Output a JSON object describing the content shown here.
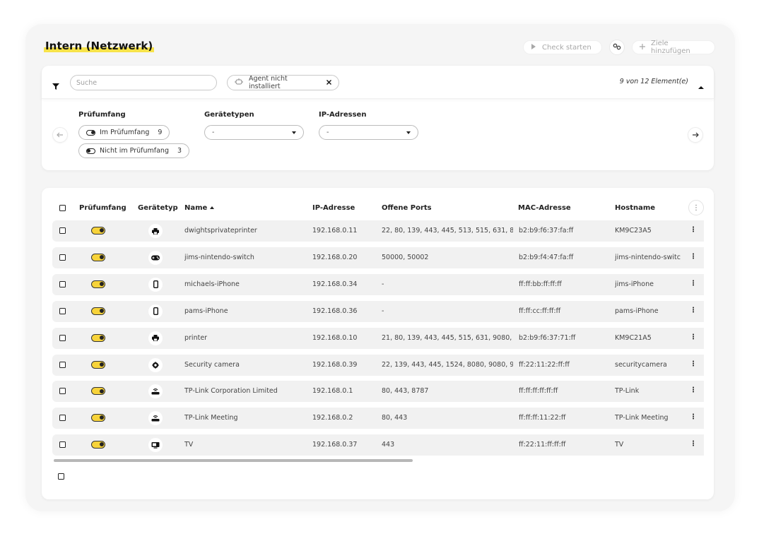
{
  "page": {
    "title": "Intern (Netzwerk)"
  },
  "actions": {
    "check_label": "Check starten",
    "add_label": "Ziele hinzufügen"
  },
  "filter_bar": {
    "search_placeholder": "Suche",
    "active_chip": "Agent nicht installiert",
    "count_label": "9 von 12 Element(e)"
  },
  "filters": {
    "scope": {
      "title": "Prüfumfang",
      "options": [
        {
          "label": "Im Prüfumfang",
          "count": "9"
        },
        {
          "label": "Nicht im Prüfumfang",
          "count": "3"
        }
      ]
    },
    "device_types": {
      "title": "Gerätetypen",
      "value": "-"
    },
    "ip_addresses": {
      "title": "IP-Adressen",
      "value": "-"
    }
  },
  "table": {
    "columns": {
      "scope": "Prüfumfang",
      "type": "Gerätetyp",
      "name": "Name",
      "ip": "IP-Adresse",
      "ports": "Offene Ports",
      "mac": "MAC-Adresse",
      "hostname": "Hostname"
    },
    "rows": [
      {
        "icon": "printer-icon",
        "name": "dwightsprivateprinter",
        "ip": "192.168.0.11",
        "ports": "22, 80, 139, 443, 445, 513, 515, 631, 8...",
        "mac": "b2:b9:f6:37:fa:ff",
        "hostname": "KM9C23A5"
      },
      {
        "icon": "gamepad-icon",
        "name": "jims-nintendo-switch",
        "ip": "192.168.0.20",
        "ports": "50000, 50002",
        "mac": "b2:b9:f4:47:fa:ff",
        "hostname": "jims-nintendo-switc"
      },
      {
        "icon": "smartphone-icon",
        "name": "michaels-iPhone",
        "ip": "192.168.0.34",
        "ports": "-",
        "mac": "ff:ff:bb:ff:ff:ff",
        "hostname": "jims-iPhone"
      },
      {
        "icon": "smartphone-icon",
        "name": "pams-iPhone",
        "ip": "192.168.0.36",
        "ports": "-",
        "mac": "ff:ff:cc:ff:ff:ff",
        "hostname": "pams-iPhone"
      },
      {
        "icon": "printer-icon",
        "name": "printer",
        "ip": "192.168.0.10",
        "ports": "21, 80, 139, 443, 445, 515, 631, 9080, ...",
        "mac": "b2:b9:f6:37:71:ff",
        "hostname": "KM9C21A5"
      },
      {
        "icon": "camera-icon",
        "name": "Security camera",
        "ip": "192.168.0.39",
        "ports": "22, 139, 443, 445, 1524, 8080, 9080, 9...",
        "mac": "ff:22:11:22:ff:ff",
        "hostname": "securitycamera"
      },
      {
        "icon": "router-icon",
        "name": "TP-Link Corporation Limited",
        "ip": "192.168.0.1",
        "ports": "80, 443, 8787",
        "mac": "ff:ff:ff:ff:ff:ff",
        "hostname": "TP-Link"
      },
      {
        "icon": "router-icon",
        "name": "TP-Link Meeting",
        "ip": "192.168.0.2",
        "ports": "80, 443",
        "mac": "ff:ff:ff:11:22:ff",
        "hostname": "TP-Link Meeting"
      },
      {
        "icon": "tv-icon",
        "name": "TV",
        "ip": "192.168.0.37",
        "ports": "443",
        "mac": "ff:22:11:ff:ff:ff",
        "hostname": "TV"
      }
    ]
  }
}
